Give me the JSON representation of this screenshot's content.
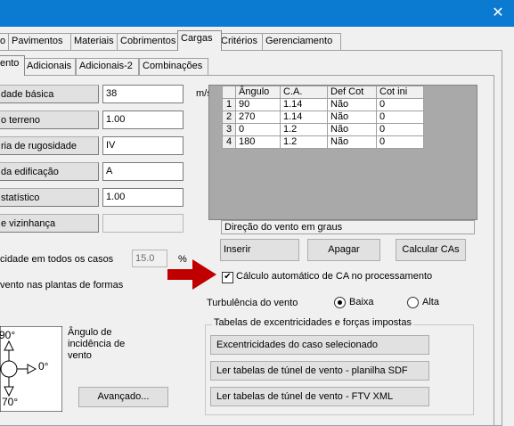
{
  "window": {
    "close_glyph": "✕"
  },
  "main_tabs": [
    "o",
    "Pavimentos",
    "Materiais",
    "Cobrimentos",
    "Cargas",
    "Critérios",
    "Gerenciamento"
  ],
  "sub_tabs": [
    "ento",
    "Adicionais",
    "Adicionais-2",
    "Combinações"
  ],
  "wind_params": [
    {
      "label": "dade básica",
      "value": "38"
    },
    {
      "label": "o terreno",
      "value": "1.00"
    },
    {
      "label": "ria de rugosidade",
      "value": "IV"
    },
    {
      "label": "da edificação",
      "value": "A"
    },
    {
      "label": "statístico",
      "value": "1.00"
    },
    {
      "label": "e vizinhança",
      "value": ""
    }
  ],
  "unit_ms": "m/s",
  "speed_all_cases": {
    "label": "cidade em todos os casos",
    "value": "15.0",
    "unit": "%"
  },
  "wind_in_plans_label": "vento nas plantas de formas",
  "angle_diagram": {
    "top": "90°",
    "right": "0°",
    "bottom": "70°"
  },
  "angle_caption": "Ângulo de\nincidência de\nvento",
  "advanced_button": "Avançado...",
  "table": {
    "headers": [
      "",
      "Ângulo",
      "C.A.",
      "Def Cot",
      "Cot ini"
    ],
    "rows": [
      [
        "1",
        "90",
        "1.14",
        "Não",
        "0"
      ],
      [
        "2",
        "270",
        "1.14",
        "Não",
        "0"
      ],
      [
        "3",
        "0",
        "1.2",
        "Não",
        "0"
      ],
      [
        "4",
        "180",
        "1.2",
        "Não",
        "0"
      ]
    ]
  },
  "table_status": "Direção do vento em graus",
  "buttons": {
    "insert": "Inserir",
    "delete": "Apagar",
    "calc": "Calcular CAs"
  },
  "auto_calc": {
    "label": "Cálculo automático de CA no processamento",
    "checked": true
  },
  "turbulence": {
    "label": "Turbulência do vento",
    "options": [
      "Baixa",
      "Alta"
    ],
    "selected": "Baixa"
  },
  "tables_group": {
    "title": "Tabelas de excentricidades e forças impostas",
    "buttons": [
      "Excentricidades do caso selecionado",
      "Ler tabelas de túnel de vento - planilha SDF",
      "Ler tabelas de túnel de vento - FTV XML"
    ]
  },
  "colors": {
    "titlebar": "#0b7ad1",
    "arrow": "#c00000"
  }
}
